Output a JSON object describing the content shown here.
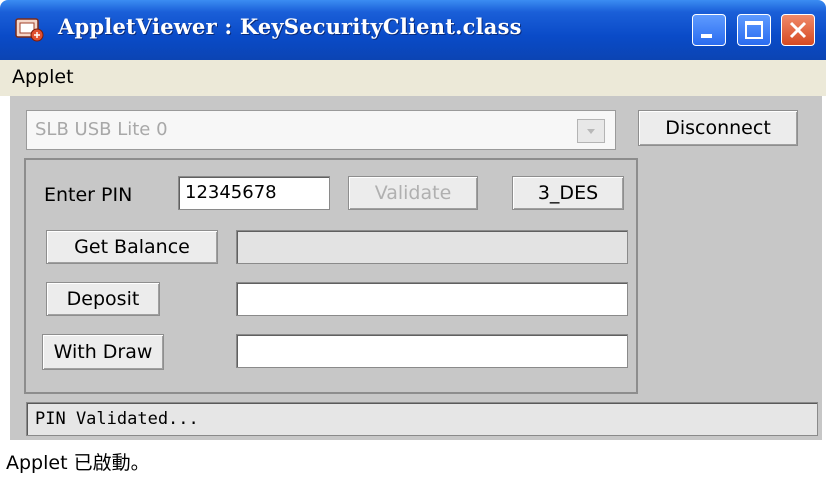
{
  "window": {
    "title": "AppletViewer : KeySecurityClient.class",
    "icons": [
      "java-applet-icon",
      "minimize-icon",
      "maximize-icon",
      "close-icon"
    ]
  },
  "menu": {
    "items": [
      "Applet"
    ]
  },
  "reader_select": {
    "value": "SLB USB Lite 0"
  },
  "buttons": {
    "disconnect": "Disconnect",
    "validate": "Validate",
    "des": "3_DES",
    "get_balance": "Get Balance",
    "deposit": "Deposit",
    "withdraw": "With Draw"
  },
  "pin": {
    "label": "Enter PIN",
    "value": "12345678"
  },
  "fields": {
    "balance": "",
    "deposit": "",
    "withdraw": ""
  },
  "status_message": "PIN Validated...",
  "applet_status": "Applet 已啟動。",
  "colors": {
    "titlebar": "#0a4bc8",
    "close_button": "#d64a22",
    "panel_bg": "#c7c7c7"
  }
}
